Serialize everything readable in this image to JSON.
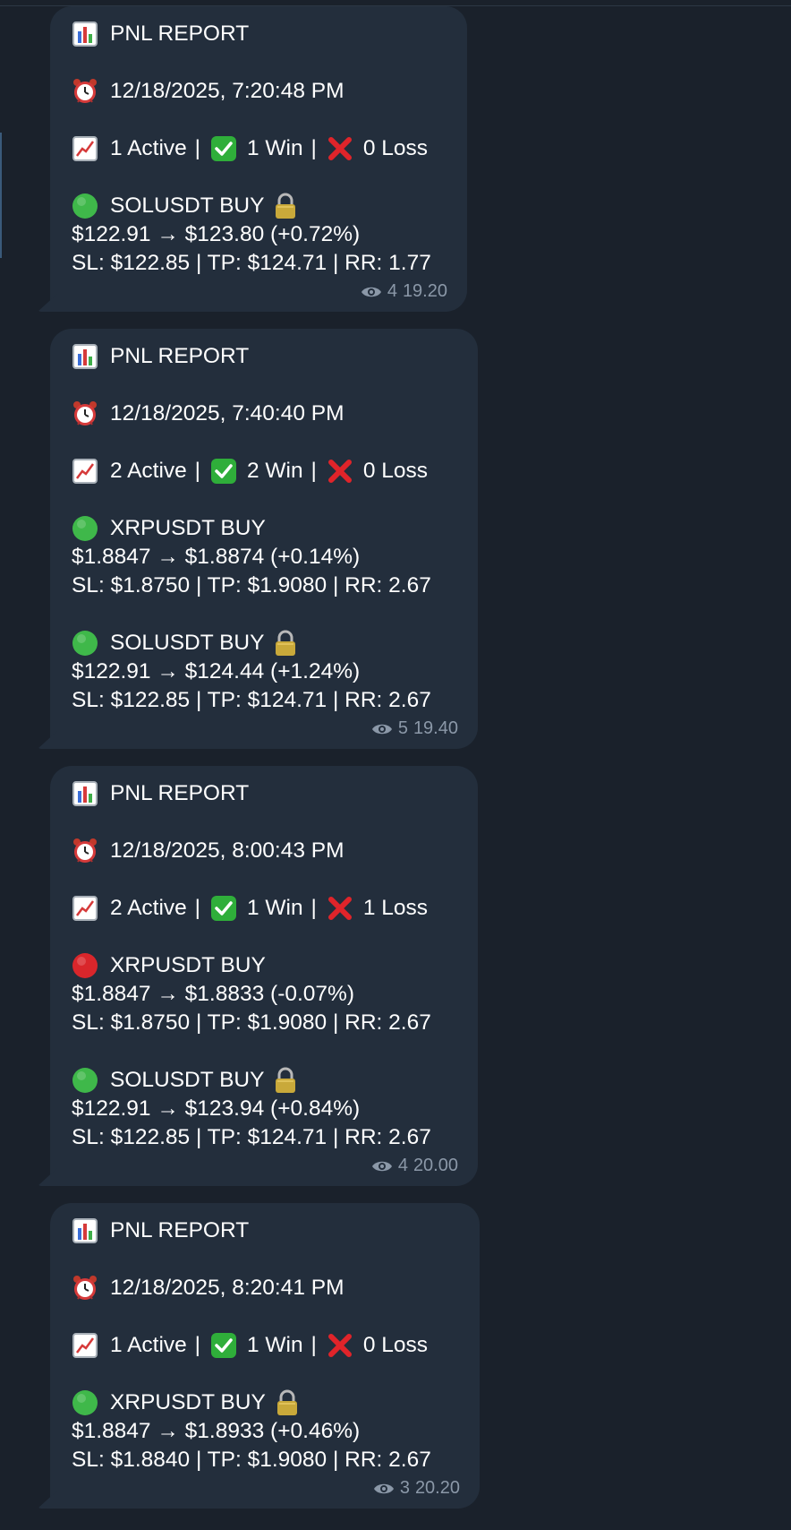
{
  "messages": [
    {
      "title": "PNL REPORT",
      "timestamp": "12/18/2025, 7:20:48 PM",
      "active": "1 Active",
      "win": "1 Win",
      "loss": "0 Loss",
      "trades": [
        {
          "status": "green",
          "pair": "SOLUSDT BUY",
          "locked": true,
          "price": "$122.91 → $123.80 (+0.72%)",
          "levels": "SL: $122.85 | TP: $124.71 | RR: 1.77"
        }
      ],
      "views": "4",
      "time": "19.20"
    },
    {
      "title": "PNL REPORT",
      "timestamp": "12/18/2025, 7:40:40 PM",
      "active": "2 Active",
      "win": "2 Win",
      "loss": "0 Loss",
      "trades": [
        {
          "status": "green",
          "pair": "XRPUSDT BUY",
          "locked": false,
          "price": "$1.8847 → $1.8874 (+0.14%)",
          "levels": "SL: $1.8750 | TP: $1.9080 | RR: 2.67"
        },
        {
          "status": "green",
          "pair": "SOLUSDT BUY",
          "locked": true,
          "price": "$122.91 → $124.44 (+1.24%)",
          "levels": "SL: $122.85 | TP: $124.71 | RR: 2.67"
        }
      ],
      "views": "5",
      "time": "19.40"
    },
    {
      "title": "PNL REPORT",
      "timestamp": "12/18/2025, 8:00:43 PM",
      "active": "2 Active",
      "win": "1 Win",
      "loss": "1 Loss",
      "trades": [
        {
          "status": "red",
          "pair": "XRPUSDT BUY",
          "locked": false,
          "price": "$1.8847 → $1.8833 (-0.07%)",
          "levels": "SL: $1.8750 | TP: $1.9080 | RR: 2.67"
        },
        {
          "status": "green",
          "pair": "SOLUSDT BUY",
          "locked": true,
          "price": "$122.91 → $123.94 (+0.84%)",
          "levels": "SL: $122.85 | TP: $124.71 | RR: 2.67"
        }
      ],
      "views": "4",
      "time": "20.00"
    },
    {
      "title": "PNL REPORT",
      "timestamp": "12/18/2025, 8:20:41 PM",
      "active": "1 Active",
      "win": "1 Win",
      "loss": "0 Loss",
      "trades": [
        {
          "status": "green",
          "pair": "XRPUSDT BUY",
          "locked": true,
          "price": "$1.8847 → $1.8933 (+0.46%)",
          "levels": "SL: $1.8840 | TP: $1.9080 | RR: 2.67"
        }
      ],
      "views": "3",
      "time": "20.20"
    }
  ],
  "icons": {
    "title": "bar-chart-icon",
    "timestamp": "alarm-clock-icon",
    "stats": "chart-increasing-icon",
    "win": "check-mark-button-icon",
    "loss": "cross-mark-icon",
    "status_green": "green-circle-icon",
    "status_red": "red-circle-icon",
    "lock": "lock-icon",
    "views": "eye-icon"
  },
  "colors": {
    "background": "#1a212b",
    "bubble": "#232e3c",
    "text": "#ffffff",
    "meta": "#8b98a8",
    "green": "#3fb84a",
    "red": "#d9262b",
    "check": "#2fae3a"
  }
}
